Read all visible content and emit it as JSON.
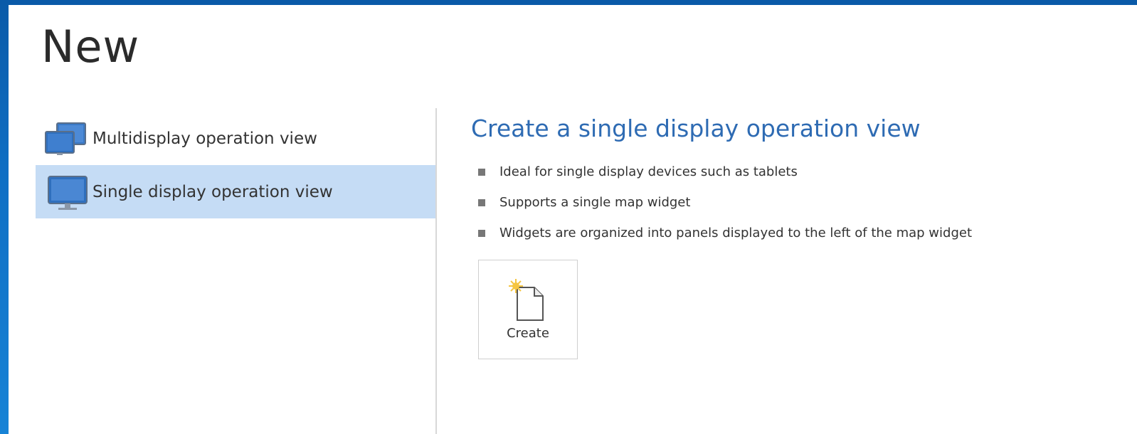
{
  "page": {
    "title": "New"
  },
  "sidebar": {
    "items": [
      {
        "label": "Multidisplay operation view",
        "icon": "multi-monitor-icon",
        "selected": false
      },
      {
        "label": "Single display operation view",
        "icon": "monitor-icon",
        "selected": true
      }
    ]
  },
  "detail": {
    "heading": "Create a single display operation view",
    "bullets": [
      "Ideal for single display devices such as tablets",
      "Supports a single map widget",
      "Widgets are organized into panels displayed to the left of the map widget"
    ],
    "create_button": {
      "label": "Create",
      "icon": "new-document-icon"
    }
  },
  "colors": {
    "background_blue": "#0f6fc4",
    "heading_blue": "#2e6bb3",
    "selected_row": "#c5dcf5",
    "monitor_blue": "#2f6fbd"
  }
}
